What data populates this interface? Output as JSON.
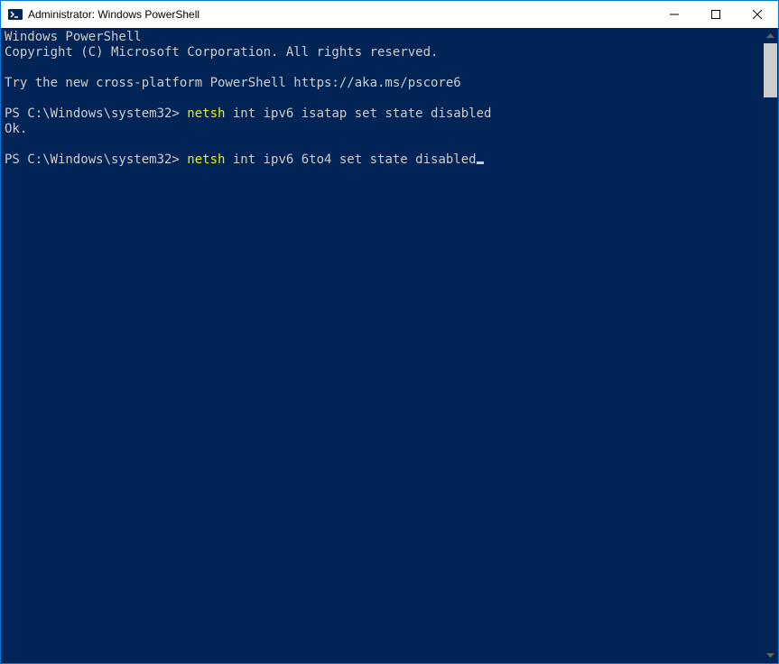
{
  "titlebar": {
    "title": "Administrator: Windows PowerShell"
  },
  "terminal": {
    "line1": "Windows PowerShell",
    "line2": "Copyright (C) Microsoft Corporation. All rights reserved.",
    "line3": "",
    "line4": "Try the new cross-platform PowerShell https://aka.ms/pscore6",
    "line5": "",
    "prompt1": "PS C:\\Windows\\system32> ",
    "cmd1_exe": "netsh ",
    "cmd1_args": "int ipv6 isatap set state disabled",
    "result1": "Ok.",
    "line_blank": "",
    "prompt2": "PS C:\\Windows\\system32> ",
    "cmd2_exe": "netsh ",
    "cmd2_args": "int ipv6 6to4 set state disabled"
  }
}
